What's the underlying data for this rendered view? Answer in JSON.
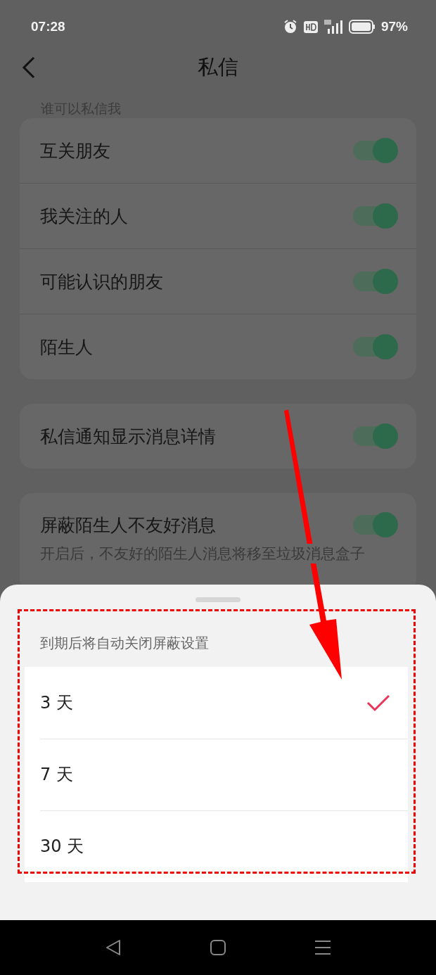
{
  "status_bar": {
    "time": "07:28",
    "battery": "97%"
  },
  "header": {
    "title": "私信"
  },
  "section_label": "谁可以私信我",
  "who_can_message": [
    {
      "label": "互关朋友",
      "on": true
    },
    {
      "label": "我关注的人",
      "on": true
    },
    {
      "label": "可能认识的朋友",
      "on": true
    },
    {
      "label": "陌生人",
      "on": true
    }
  ],
  "notification_details": {
    "label": "私信通知显示消息详情",
    "on": true
  },
  "block_strangers": {
    "label": "屏蔽陌生人不友好消息",
    "on": true,
    "description": "开启后，不友好的陌生人消息将移至垃圾消息盒子"
  },
  "sheet": {
    "title": "到期后将自动关闭屏蔽设置",
    "options": [
      {
        "label": "3 天",
        "selected": true
      },
      {
        "label": "7 天",
        "selected": false
      },
      {
        "label": "30 天",
        "selected": false
      }
    ]
  }
}
